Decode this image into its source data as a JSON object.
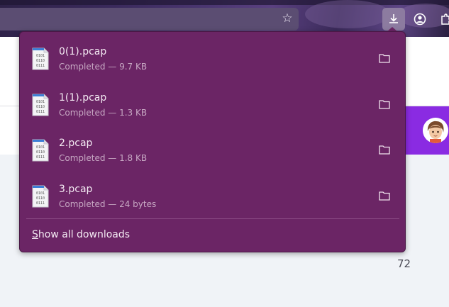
{
  "browser": {
    "toolbar_buttons": [
      {
        "name": "download-icon"
      },
      {
        "name": "account-icon"
      },
      {
        "name": "extensions-icon"
      }
    ]
  },
  "downloads": {
    "items": [
      {
        "filename": "0(1).pcap",
        "status": "Completed — 9.7 KB"
      },
      {
        "filename": "1(1).pcap",
        "status": "Completed — 1.3 KB"
      },
      {
        "filename": "2.pcap",
        "status": "Completed — 1.8 KB"
      },
      {
        "filename": "3.pcap",
        "status": "Completed — 24 bytes"
      }
    ],
    "show_all_accesskey": "S",
    "show_all_rest": "how all downloads"
  },
  "page": {
    "number": "72"
  },
  "colors": {
    "panel_bg": "#6b2565",
    "accent": "#8a2be2"
  }
}
